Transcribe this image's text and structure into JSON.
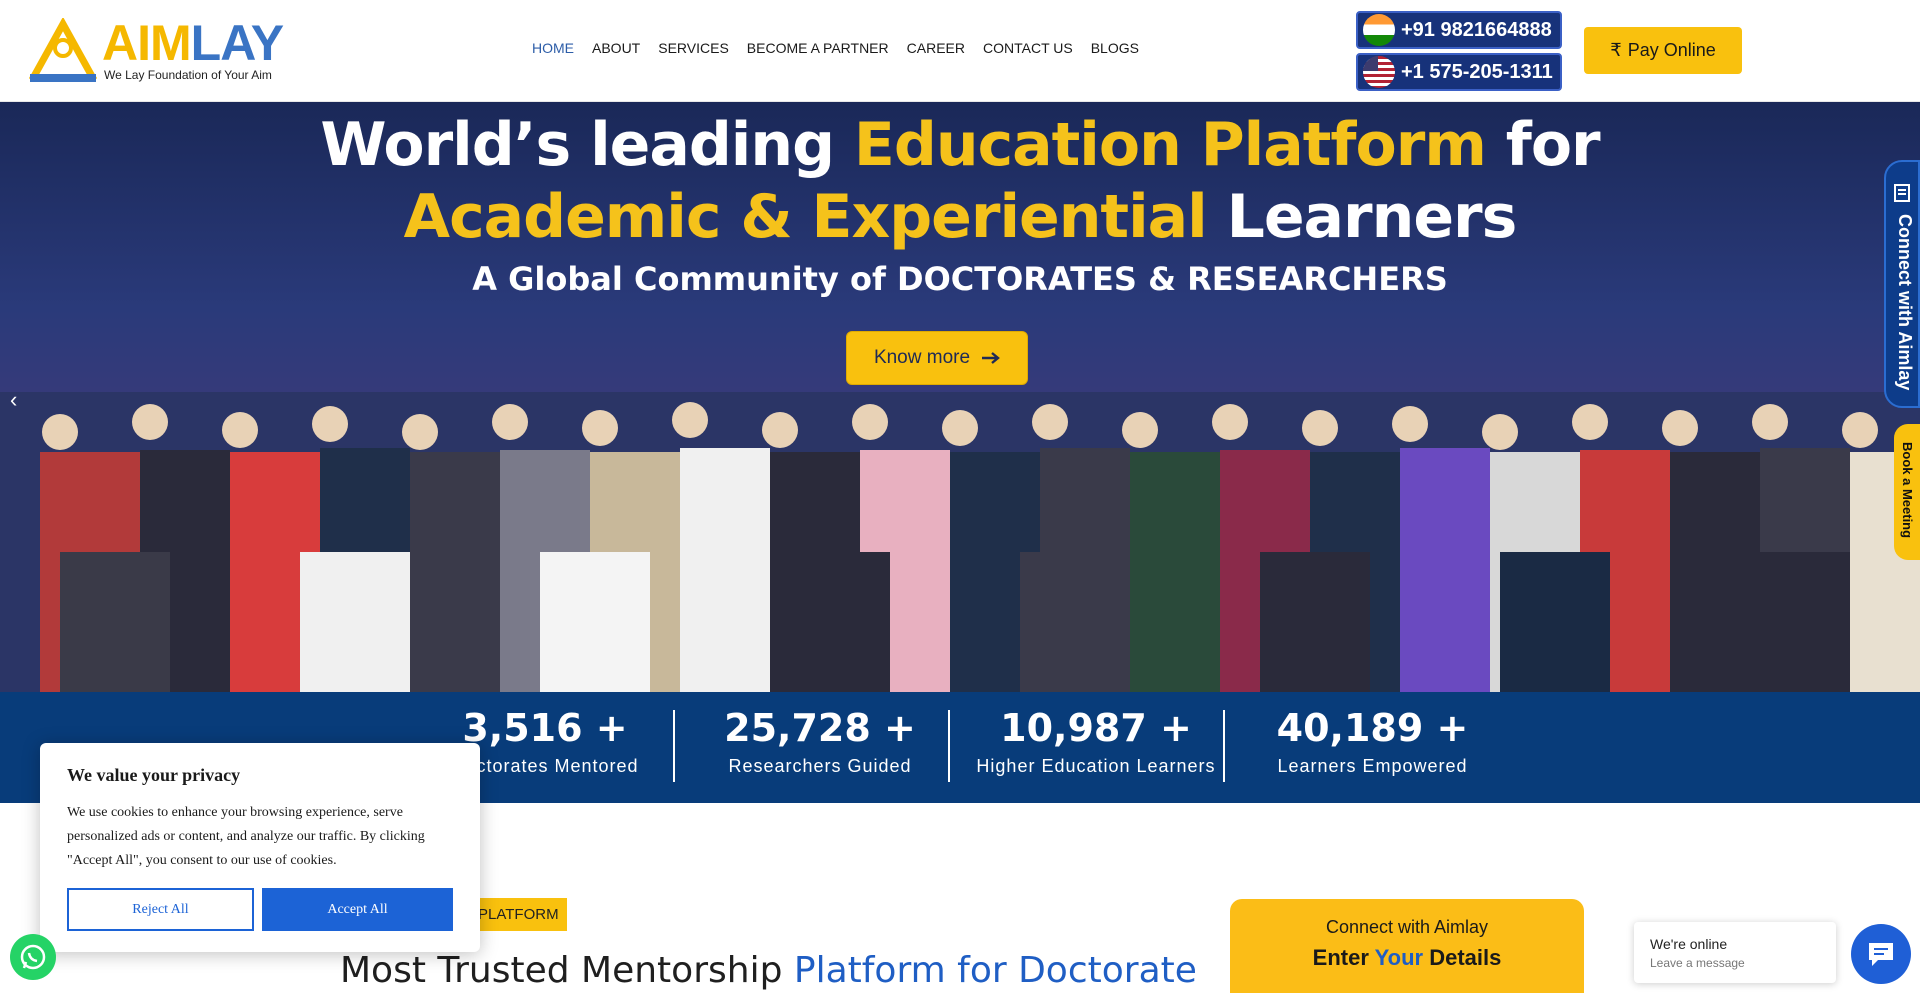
{
  "brand": {
    "logo_aim": "AIM",
    "logo_lay": "LAY",
    "tagline": "We Lay Foundation of Your Aim"
  },
  "nav": {
    "items": [
      {
        "label": "HOME"
      },
      {
        "label": "ABOUT"
      },
      {
        "label": "SERVICES"
      },
      {
        "label": "BECOME A PARTNER"
      },
      {
        "label": "CAREER"
      },
      {
        "label": "CONTACT US"
      },
      {
        "label": "BLOGS"
      }
    ]
  },
  "phones": [
    {
      "number": "+91 9821664888",
      "flag": "india-flag-icon"
    },
    {
      "number": "+1 575-205-1311",
      "flag": "usa-flag-icon"
    }
  ],
  "pay_button": {
    "symbol": "₹",
    "label": "Pay Online"
  },
  "hero": {
    "line1_a": "World’s leading ",
    "line1_b": "Education Platform",
    "line1_c": " for",
    "line2_a": "Academic & Experiential",
    "line2_b": " Learners",
    "subtitle": "A Global Community of DOCTORATES & RESEARCHERS",
    "cta": "Know more",
    "prev_icon": "‹"
  },
  "side_tabs": {
    "connect": "Connect with Aimlay",
    "meeting": "Book a Meeting"
  },
  "stats": [
    {
      "value": "3,516",
      "suffix": "+",
      "label": "Doctorates Mentored"
    },
    {
      "value": "25,728",
      "suffix": "+",
      "label": "Researchers Guided"
    },
    {
      "value": "10,987",
      "suffix": "+",
      "label": "Higher Education Learners"
    },
    {
      "value": "40,189",
      "suffix": "+",
      "label": "Learners Empowered"
    }
  ],
  "section": {
    "tag": "PLATFORM",
    "heading_a": "Most Trusted Mentorship ",
    "heading_b": "Platform for Doctorate"
  },
  "connect_card": {
    "title": "Connect with Aimlay",
    "enter": "Enter ",
    "your": "Your",
    "details": " Details"
  },
  "cookie": {
    "title": "We value your privacy",
    "body": "We use cookies to enhance your browsing experience, serve personalized ads or content, and analyze our traffic. By clicking \"Accept All\", you consent to our use of cookies.",
    "reject": "Reject All",
    "accept": "Accept All"
  },
  "chat": {
    "status": "We're online",
    "prompt": "Leave a message"
  },
  "colors": {
    "brand_yellow": "#f9c10e",
    "brand_blue": "#083c7a",
    "accent_blue": "#1f5ec4"
  }
}
